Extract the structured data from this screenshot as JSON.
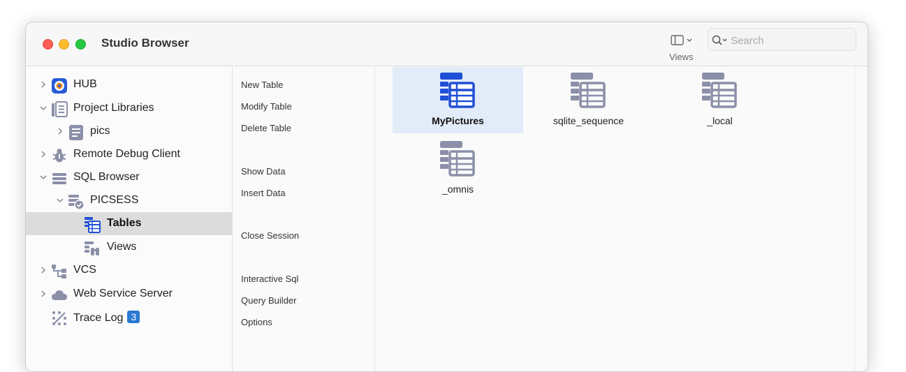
{
  "window": {
    "title": "Studio Browser"
  },
  "toolbar": {
    "views_label": "Views",
    "search_placeholder": "Search"
  },
  "sidebar": {
    "items": [
      {
        "label": "HUB",
        "icon": "hub-icon"
      },
      {
        "label": "Project Libraries",
        "icon": "libraries-icon"
      },
      {
        "label": "pics",
        "icon": "library-icon"
      },
      {
        "label": "Remote Debug Client",
        "icon": "bug-icon"
      },
      {
        "label": "SQL Browser",
        "icon": "sql-browser-icon"
      },
      {
        "label": "PICSESS",
        "icon": "session-icon"
      },
      {
        "label": "Tables",
        "icon": "tables-icon"
      },
      {
        "label": "Views",
        "icon": "views-icon"
      },
      {
        "label": "VCS",
        "icon": "vcs-icon"
      },
      {
        "label": "Web Service Server",
        "icon": "cloud-icon"
      },
      {
        "label": "Trace Log",
        "icon": "trace-log-icon",
        "badge": "3"
      }
    ]
  },
  "actions": {
    "new_table": "New Table",
    "modify_table": "Modify Table",
    "delete_table": "Delete Table",
    "show_data": "Show Data",
    "insert_data": "Insert Data",
    "close_session": "Close Session",
    "interactive_sql": "Interactive Sql",
    "query_builder": "Query Builder",
    "options": "Options"
  },
  "tables": [
    {
      "name": "MyPictures",
      "selected": true
    },
    {
      "name": "sqlite_sequence",
      "selected": false
    },
    {
      "name": "_local",
      "selected": false
    },
    {
      "name": "_omnis",
      "selected": false
    }
  ],
  "colors": {
    "accent": "#1f4fd6",
    "icon_gray": "#8b8fa8",
    "selection": "#e2ebf8",
    "badge": "#2a7ad2"
  }
}
